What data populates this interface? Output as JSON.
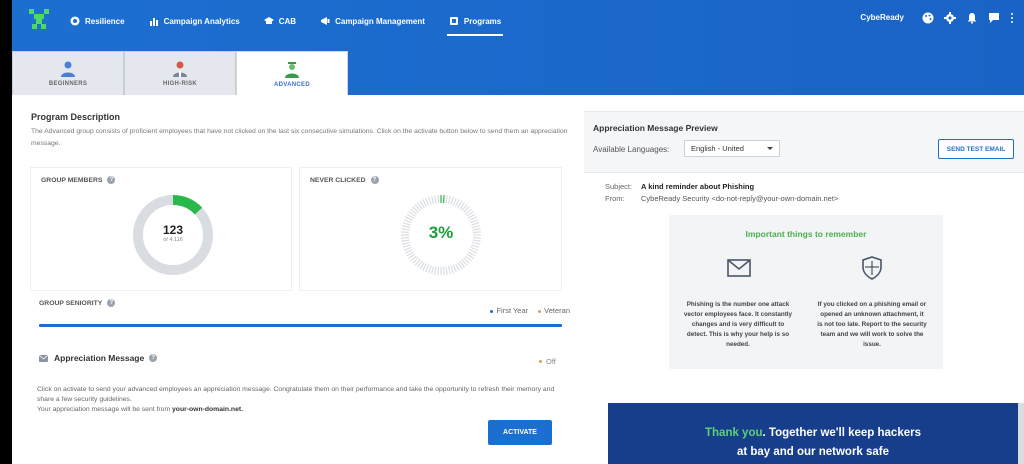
{
  "header": {
    "nav": [
      {
        "label": "Resilience",
        "icon": "resilience-icon"
      },
      {
        "label": "Campaign Analytics",
        "icon": "analytics-icon"
      },
      {
        "label": "CAB",
        "icon": "cab-icon"
      },
      {
        "label": "Campaign Management",
        "icon": "campaign-icon"
      },
      {
        "label": "Programs",
        "icon": "programs-icon"
      }
    ],
    "active_nav": "Programs",
    "user": "CybeReady"
  },
  "tabs": [
    {
      "label": "BEGINNERS"
    },
    {
      "label": "HIGH-RISK"
    },
    {
      "label": "ADVANCED"
    }
  ],
  "program": {
    "title": "Program Description",
    "description": "The Advanced group consists of proficient employees that have not clicked on the last six consecutive simulations. Click on the activate button below to send them an appreciation message."
  },
  "group_members": {
    "title": "GROUP MEMBERS",
    "count": "123",
    "total": "of 4,116",
    "fraction": 0.03
  },
  "never_clicked": {
    "title": "NEVER CLICKED",
    "percent": "3%",
    "fraction": 0.03
  },
  "seniority": {
    "title": "GROUP SENIORITY",
    "legend": [
      "First Year",
      "Veteran"
    ],
    "first_year_color": "#1a6fd1",
    "veteran_color": "#e0a060"
  },
  "appreciation": {
    "title": "Appreciation Message",
    "status": "Off",
    "body_line1": "Click on activate to send your advanced employees an appreciation message. Congratulate them on their performance and take the opportunity to refresh their memory and share a few security guidelines.",
    "body_line2_prefix": "Your appreciation message will be sent from ",
    "body_line2_domain": "your-own-domain.net.",
    "activate_label": "ACTIVATE"
  },
  "preview": {
    "title": "Appreciation Message Preview",
    "languages_label": "Available Languages:",
    "language_selected": "English - United",
    "test_email_label": "SEND TEST EMAIL",
    "subject_key": "Subject:",
    "subject_value": "A kind reminder about Phishing",
    "from_key": "From:",
    "from_value": "CybeReady Security <do-not-reply@your-own-domain.net>",
    "card_title": "Important things to remember",
    "card_left_text": "Phishing is the number one attack vector employees face. It constantly changes and is very difficult to detect. This is why your help is so needed.",
    "card_right_text": "If you clicked on a phishing email or opened an unknown attachment, it is not too late. Report to the security team and we will work to solve the issue.",
    "banner_highlight": "Thank you",
    "banner_rest1": ".  Together we'll keep hackers",
    "banner_line2": "at bay and our network safe"
  },
  "colors": {
    "brand_blue": "#1a6fd1",
    "green": "#2bb84a",
    "banner": "#163e8a"
  }
}
